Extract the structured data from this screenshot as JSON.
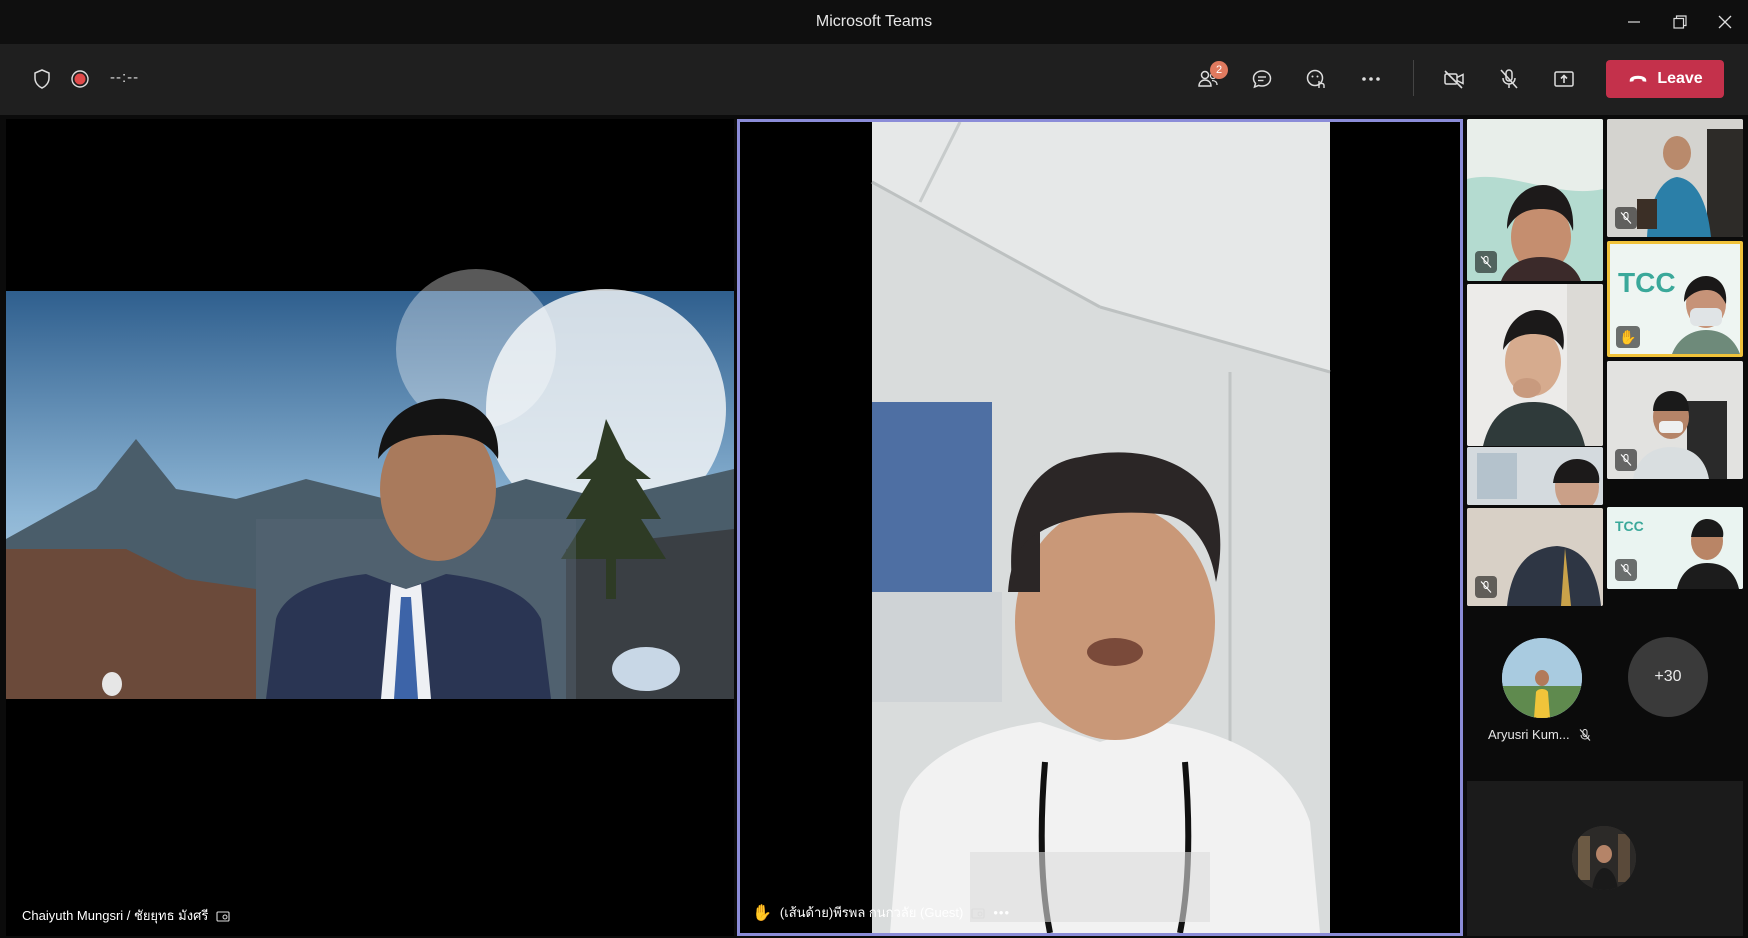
{
  "window": {
    "title": "Microsoft Teams"
  },
  "toolbar": {
    "timer": "--:--",
    "participants_badge": "2",
    "leave_label": "Leave"
  },
  "main_tiles": [
    {
      "name": "Chaiyuth Mungsri / ชัยยุทธ มังศรี"
    },
    {
      "name": "(เส้นด้าย)พีรพล กนกวลัย (Guest)"
    }
  ],
  "side_panel": {
    "overflow_name": "Aryusri Kum...",
    "more_count": "+30"
  },
  "colors": {
    "leave": "#c4314b",
    "active_border": "#8b8cd8",
    "raised_hand_border": "#f0c23a",
    "toolbar": "#1f1f1f"
  }
}
